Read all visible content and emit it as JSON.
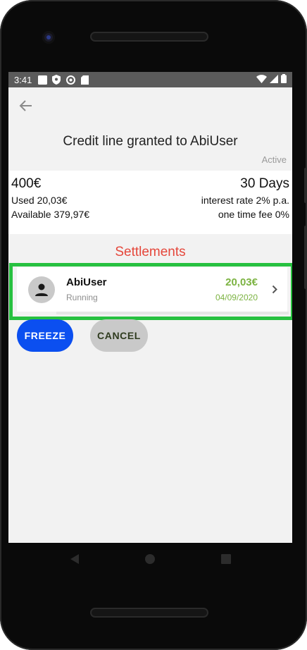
{
  "statusbar": {
    "time": "3:41",
    "icons": [
      "notification-square-icon",
      "shield-icon",
      "at-icon",
      "sd-card-icon"
    ],
    "right_icons": [
      "wifi-icon",
      "signal-icon",
      "battery-icon"
    ]
  },
  "header": {
    "title": "Credit line granted to AbiUser",
    "status": "Active"
  },
  "summary": {
    "amount": "400€",
    "duration": "30 Days",
    "used": "Used 20,03€",
    "interest": "interest rate 2% p.a.",
    "available": "Available 379,97€",
    "fee": "one time fee 0%"
  },
  "settlements": {
    "title": "Settlements",
    "items": [
      {
        "name": "AbiUser",
        "status": "Running",
        "amount": "20,03€",
        "date": "04/09/2020"
      }
    ]
  },
  "actions": {
    "freeze_label": "FREEZE",
    "cancel_label": "CANCEL"
  },
  "colors": {
    "accent_red": "#e5473b",
    "amount_green": "#7cb342",
    "freeze_blue": "#0b4ff0",
    "highlight_green": "#27c140"
  }
}
